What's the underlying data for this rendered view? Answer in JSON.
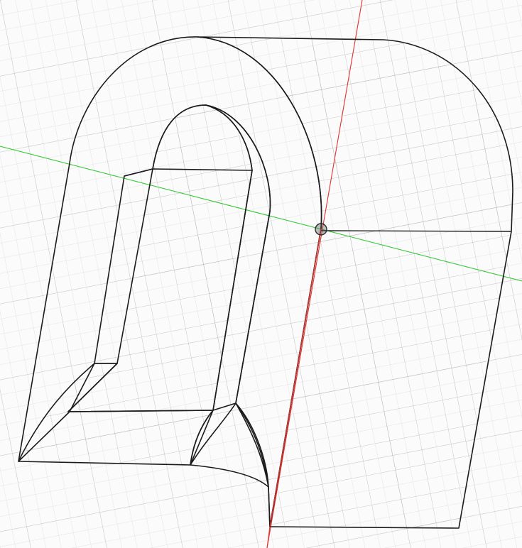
{
  "viewport": {
    "background": "#fbfbfb",
    "grid_major_color": "#c9c9c9",
    "grid_minor_color": "#e3e3e3"
  },
  "axes": {
    "x_axis_color": "#e0332f",
    "y_axis_color": "#39c83a"
  },
  "model": {
    "light_face_color": "#b6b2a6",
    "light_face_shade": "#a7a397",
    "dark_face_color": "#4a4944",
    "dark_face_shade": "#3f3e3a",
    "edge_color": "#1b1b1b"
  },
  "origin": {
    "icon": "origin-point-icon"
  }
}
